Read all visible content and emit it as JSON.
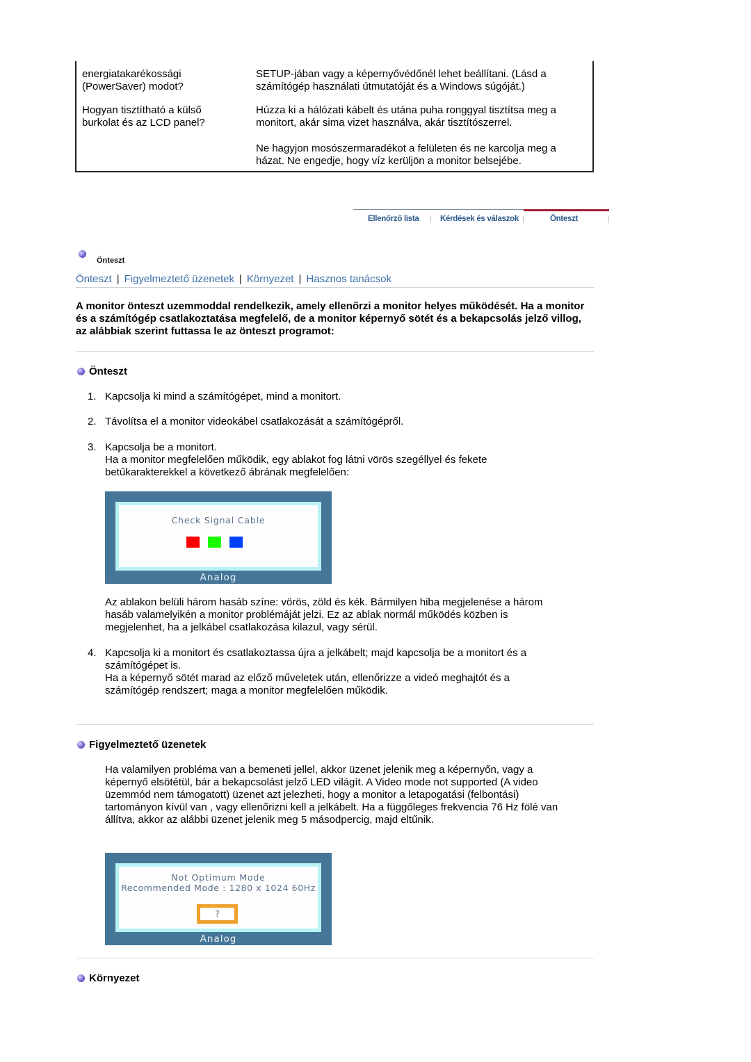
{
  "faq": [
    {
      "question": [
        "energiatakarékossági",
        "(PowerSaver) modot?"
      ],
      "answer": [
        "SETUP-jában vagy a képernyővédőnél lehet beállítani. (Lásd a",
        "számítógép használati útmutatóját és a Windows súgóját.)"
      ]
    },
    {
      "question": [
        "Hogyan tisztítható a külső",
        "burkolat és az LCD panel?"
      ],
      "answer": [
        "Húzza ki a hálózati kábelt és utána puha ronggyal tisztítsa meg a",
        "monitort, akár sima vizet használva, akár tisztítószerrel."
      ],
      "answer2": [
        "Ne hagyjon mosószermaradékot a felületen és ne karcolja meg a",
        "házat. Ne engedje, hogy víz kerüljön a monitor belsejébe."
      ]
    }
  ],
  "tabnav": {
    "items": [
      {
        "label": "Ellenőrző lista",
        "active": false
      },
      {
        "label": "Kérdések és válaszok",
        "active": false
      },
      {
        "label": "Önteszt",
        "active": true
      }
    ],
    "active_color": "#a51c2f",
    "link_color": "#2d5a8c"
  },
  "section_label": "Önteszt",
  "linkbar": {
    "items": [
      "Önteszt",
      "Figyelmeztető üzenetek",
      "Környezet",
      "Hasznos tanácsok"
    ],
    "separator": "|"
  },
  "intro": "A monitor önteszt uzemmoddal rendelkezik, amely ellenőrzi a monitor helyes működését. Ha a monitor és a számítógép csatlakoztatása megfelelő, de a monitor képernyő sötét és a bekapcsolás jelző villog, az alábbiak szerint futtassa le az önteszt programot:",
  "selftest": {
    "heading": "Önteszt",
    "steps": [
      {
        "num": "1.",
        "text": "Kapcsolja ki mind a számítógépet, mind a monitort."
      },
      {
        "num": "2.",
        "text": "Távolítsa el a monitor videokábel csatlakozását a számítógépről."
      },
      {
        "num": "3.",
        "text": "Kapcsolja be a monitort.",
        "more": "Ha a monitor megfelelően működik, egy ablakot fog látni vörös szegéllyel és fekete betűkarakterekkel a következő ábrának megfelelően:"
      },
      {
        "num": "4.",
        "text": "Kapcsolja ki a monitort és csatlakoztassa újra a jelkábelt; majd kapcsolja be a monitort és a számítógépet is.",
        "more": "Ha a képernyő sötét marad az előző műveletek után, ellenőrizze a videó meghajtót és a számítógép rendszert; maga a monitor megfelelően működik."
      }
    ],
    "after_image": "Az ablakon belüli három hasáb színe: vörös, zöld és kék. Bármilyen hiba megjelenése a három hasáb valamelyikén a monitor problémáját jelzi. Ez az ablak normál működés közben is megjelenhet, ha a jelkábel csatlakozása kilazul, vagy sérül.",
    "osd": {
      "message": "Check Signal Cable",
      "footer": "Analog",
      "swatches": [
        "#ff0000",
        "#19ff00",
        "#0040ff"
      ]
    }
  },
  "warnings": {
    "heading": "Figyelmeztető üzenetek",
    "text": "Ha valamilyen probléma van a bemeneti jellel, akkor üzenet jelenik meg a képernyőn, vagy a képernyő elsötétül, bár a bekapcsolást jelző LED világít. A Video mode not supported (A video üzemmód nem támogatott) üzenet azt jelezheti, hogy a monitor a letapogatási (felbontási) tartományon kívül van , vagy ellenőrizni kell a jelkábelt. Ha a függőleges frekvencia 76 Hz fölé van állítva, akkor az alábbi üzenet jelenik meg 5 másodpercig, majd eltűnik.",
    "osd": {
      "line1": "Not Optimum Mode",
      "line2": "Recommended Mode : 1280 x 1024  60Hz",
      "button": "?",
      "footer": "Analog",
      "button_border": "#f0a02c"
    }
  },
  "environment": {
    "heading": "Környezet"
  }
}
